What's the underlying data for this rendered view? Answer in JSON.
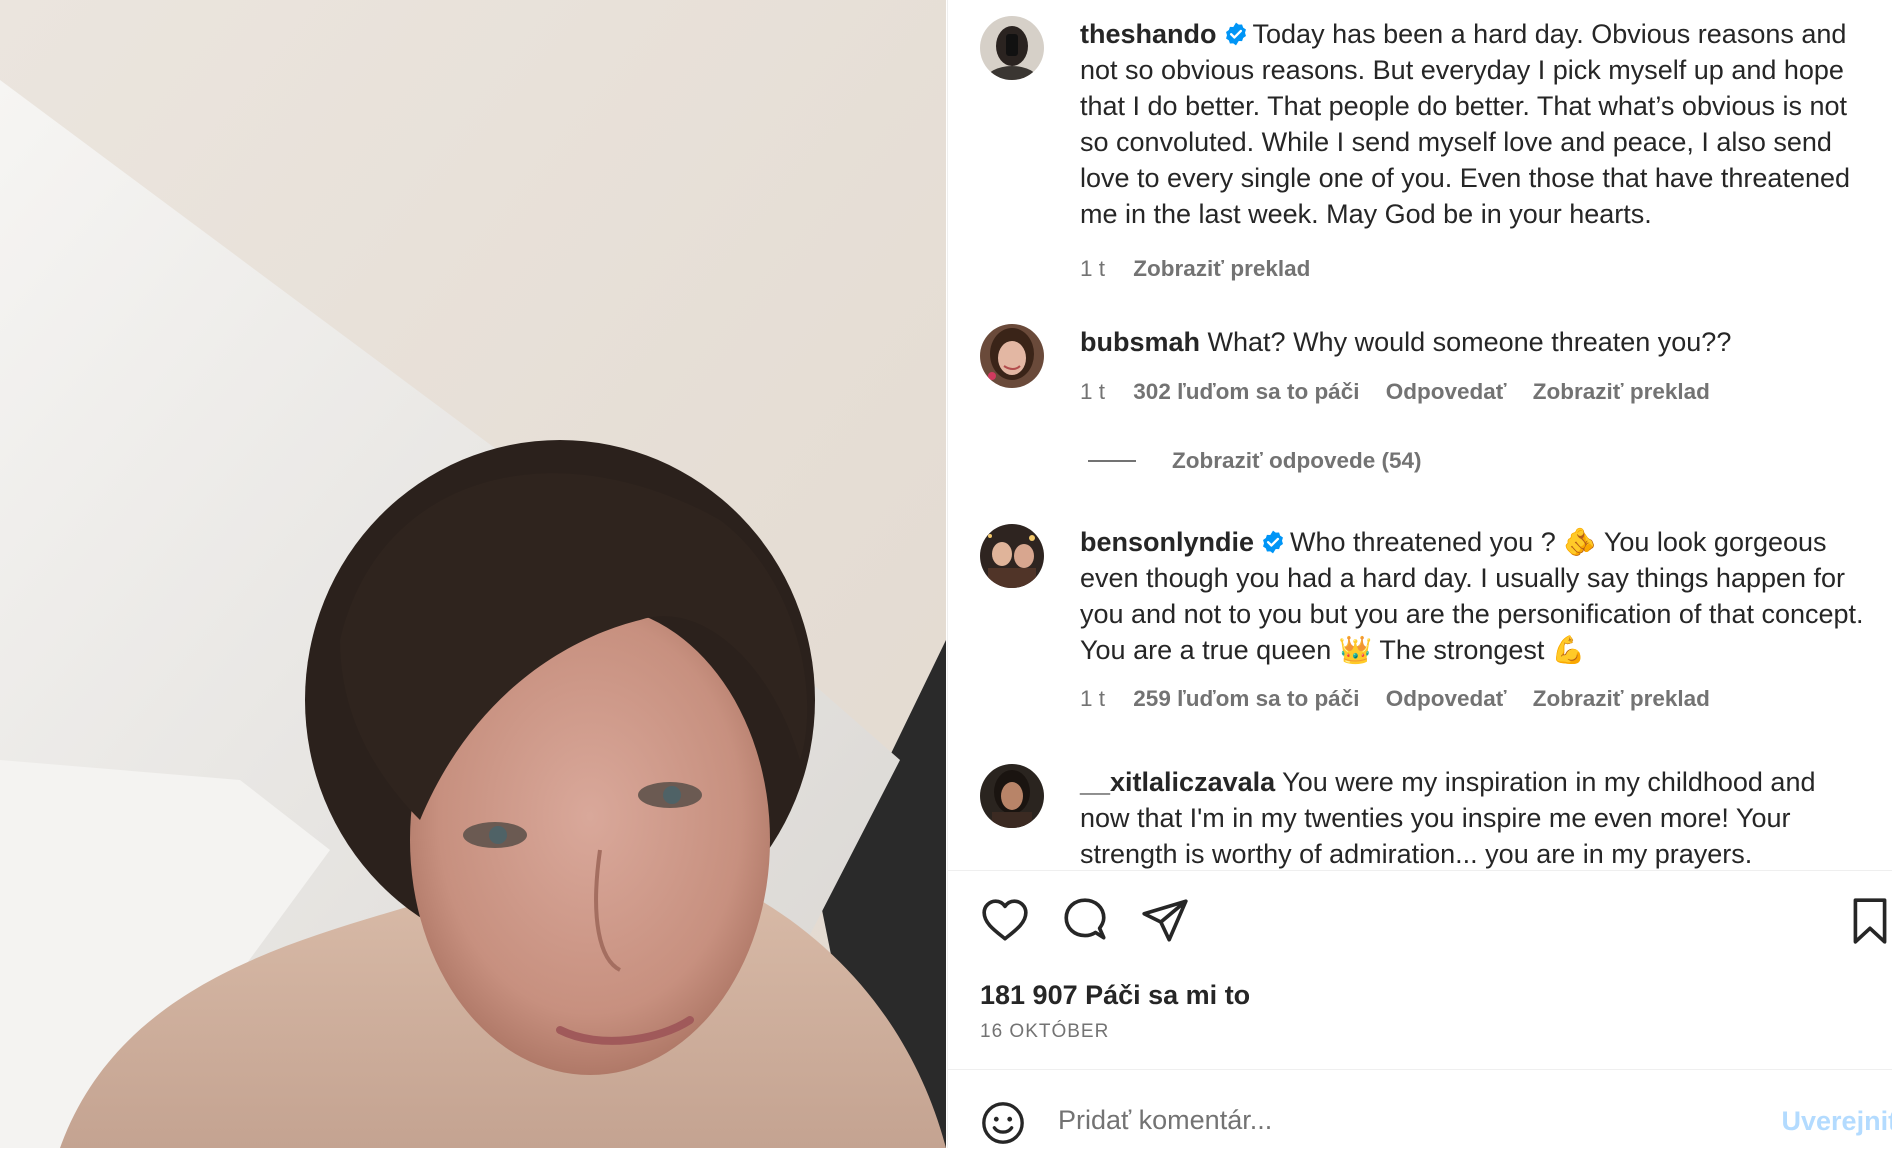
{
  "comments": [
    {
      "username": "theshando",
      "verified": true,
      "text": "Today has been a hard day. Obvious reasons and not so obvious reasons. But everyday I pick myself up and hope that I do better. That people do better. That what’s obvious is not so convoluted. While I send myself love and peace, I also send love to every single one of you. Even those that have threatened me in the last week. May God be in your hearts.",
      "time": "1 t",
      "translate": "Zobraziť preklad"
    },
    {
      "username": "bubsmah",
      "verified": false,
      "text": "What? Why would someone threaten you??",
      "time": "1 t",
      "likes": "302 ľuďom sa to páči",
      "reply": "Odpovedať",
      "translate": "Zobraziť preklad"
    },
    {
      "username": "bensonlyndie",
      "verified": true,
      "text": "Who threatened you ? 🫵 You look gorgeous even though you had a hard day. I usually say things happen for you and not to you but you are the personification of that concept. You are a true queen 👑 The strongest 💪",
      "time": "1 t",
      "likes": "259 ľuďom sa to páči",
      "reply": "Odpovedať",
      "translate": "Zobraziť preklad"
    },
    {
      "username": "__xitlaliczavala",
      "verified": false,
      "text": "You were my inspiration in my childhood and now that I'm in my twenties you inspire me even more! Your strength is worthy of admiration... you are in my prayers."
    }
  ],
  "replies_toggle": "Zobraziť odpovede (54)",
  "post": {
    "likes": "181 907 Páči sa mi to",
    "date": "16 OKTÓBER"
  },
  "input": {
    "placeholder": "Pridať komentár...",
    "post_label": "Uverejniť"
  },
  "icons": {
    "like": "heart-icon",
    "comment": "comment-icon",
    "share": "share-icon",
    "save": "bookmark-icon",
    "emoji": "emoji-icon",
    "verified": "verified-badge-icon"
  },
  "colors": {
    "verified": "#0095f6",
    "text": "#262626",
    "secondary": "#737373",
    "post_button": "#b3dbff"
  }
}
